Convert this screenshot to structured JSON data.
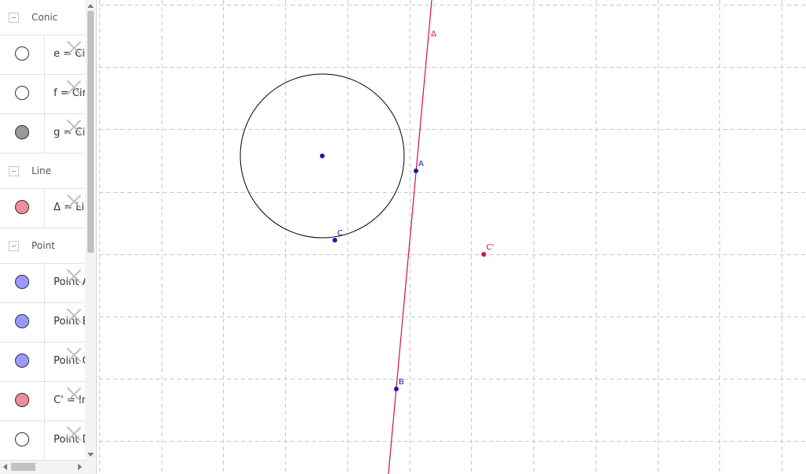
{
  "algebra": {
    "groups": [
      {
        "label": "Conic",
        "items": [
          {
            "text": "e = Circle",
            "marble": "#ffffff"
          },
          {
            "text": "f = Circle",
            "marble": "#ffffff"
          },
          {
            "text": "g = Circle",
            "marble": "#999999"
          }
        ]
      },
      {
        "label": "Line",
        "items": [
          {
            "text": "Δ = Line",
            "marble": "#f28b9b"
          }
        ]
      },
      {
        "label": "Point",
        "items": [
          {
            "text": "Point A",
            "marble": "#9999ff"
          },
          {
            "text": "Point B",
            "marble": "#9999ff"
          },
          {
            "text": "Point C",
            "marble": "#9999ff"
          },
          {
            "text": "C' = Image",
            "marble": "#f28b9b"
          },
          {
            "text": "Point D",
            "marble": "#ffffff"
          }
        ]
      }
    ]
  },
  "graphics": {
    "labels": {
      "delta": "Δ",
      "A": "A",
      "B": "B",
      "C": "C",
      "Cprime": "C'"
    },
    "colors": {
      "line": "#d40f4a",
      "point_blue": "#1a1aa6",
      "point_red": "#d40f4a",
      "circle": "#000000",
      "grid": "#c8c8c8"
    }
  }
}
